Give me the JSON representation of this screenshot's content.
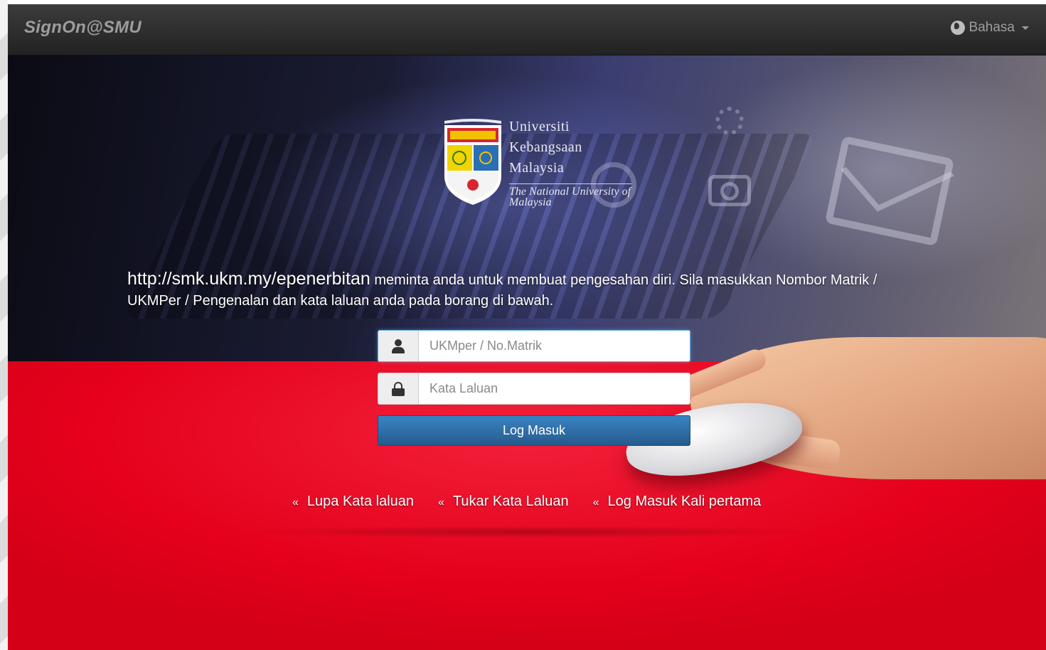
{
  "navbar": {
    "brand": "SignOn@SMU",
    "language_label": "Bahasa"
  },
  "logo": {
    "line1": "Universiti",
    "line2": "Kebangsaan",
    "line3": "Malaysia",
    "tagline": "The National University of Malaysia"
  },
  "message": {
    "url": "http://smk.ukm.my/epenerbitan",
    "text": " meminta anda untuk membuat pengesahan diri. Sila masukkan Nombor Matrik / UKMPer / Pengenalan dan kata laluan anda pada borang di bawah."
  },
  "form": {
    "username_placeholder": "UKMper / No.Matrik",
    "username_value": "",
    "password_placeholder": "Kata Laluan",
    "password_value": "",
    "submit_label": "Log Masuk"
  },
  "links": [
    {
      "chevron": "«",
      "label": "Lupa Kata laluan"
    },
    {
      "chevron": "«",
      "label": "Tukar Kata Laluan"
    },
    {
      "chevron": "«",
      "label": "Log Masuk Kali pertama"
    }
  ],
  "colors": {
    "navbar": "#2b2b2b",
    "red_background": "#e5001c",
    "button": "#2f6fa8"
  },
  "icons": {
    "language": "globe-icon",
    "username": "user-icon",
    "password": "lock-icon"
  }
}
